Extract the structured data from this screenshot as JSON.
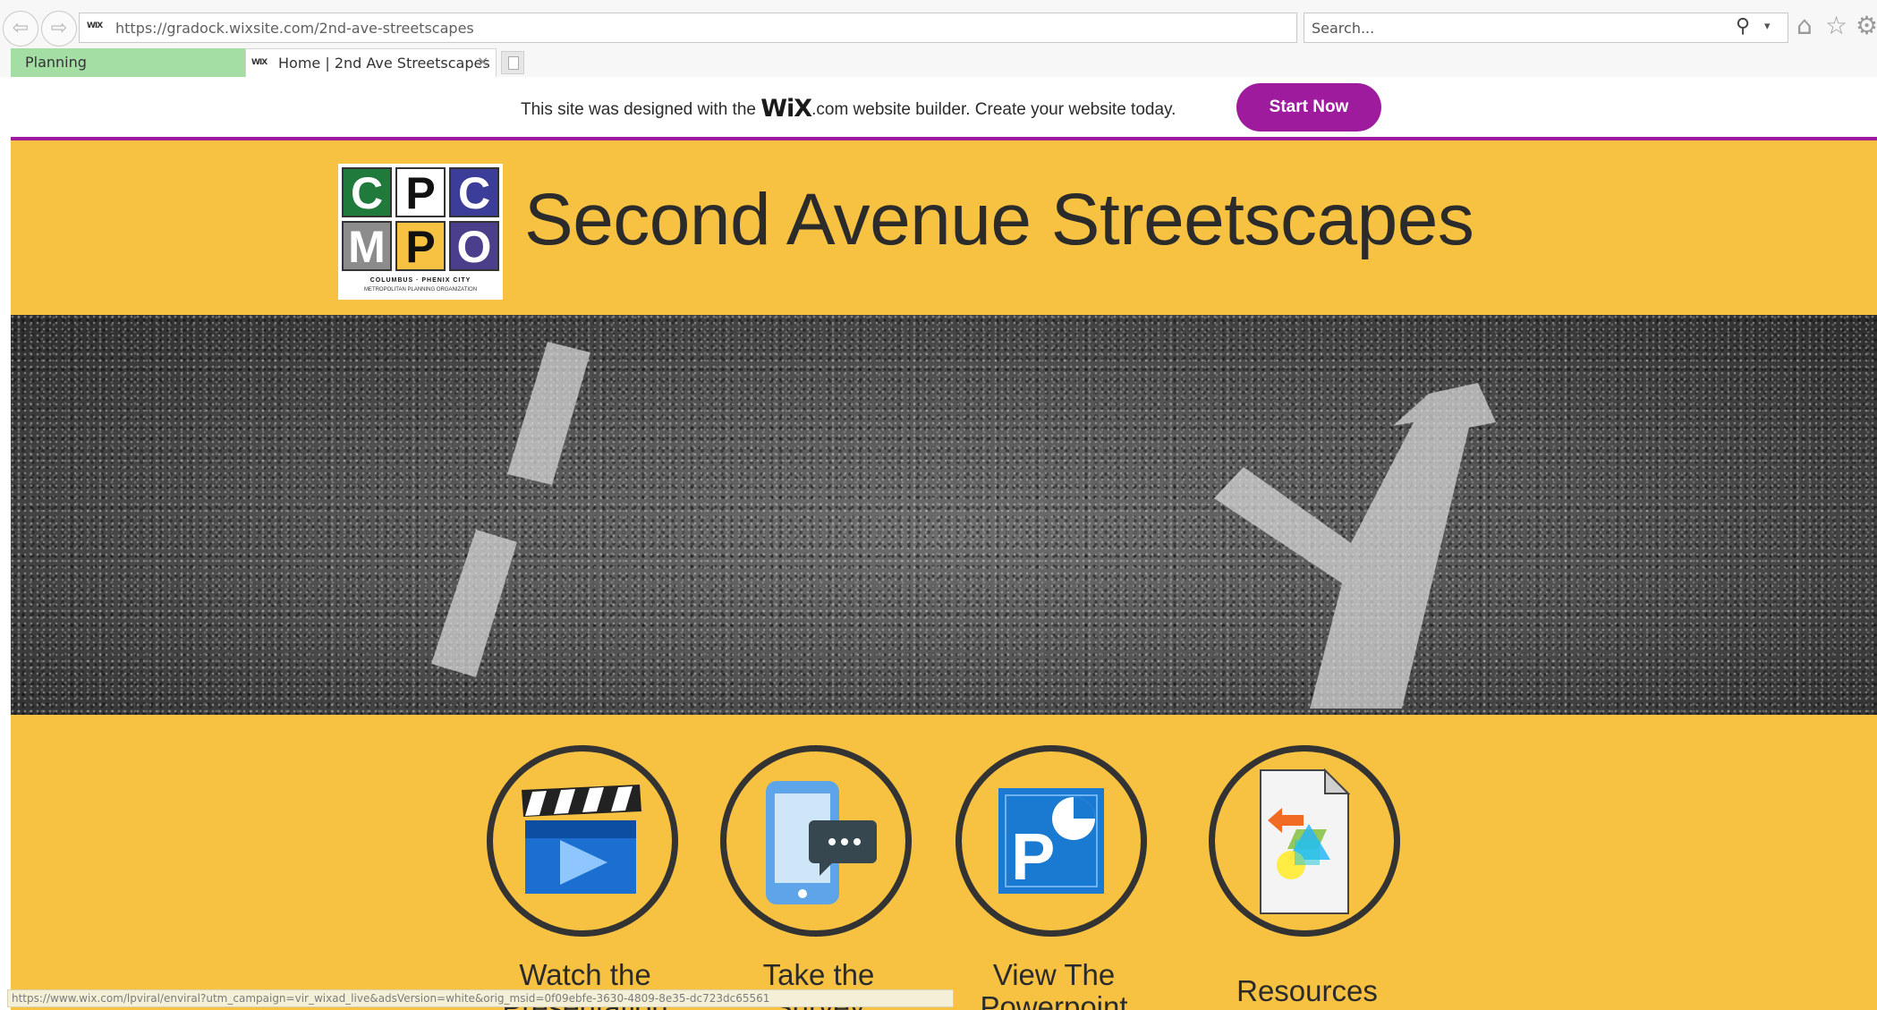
{
  "browser": {
    "address": {
      "favicon": "WIX",
      "url": "https://gradock.wixsite.com/2nd-ave-streetscapes"
    },
    "search": {
      "placeholder": "Search..."
    },
    "icons": [
      "back-icon",
      "forward-icon",
      "lock-icon",
      "refresh-icon",
      "search-icon",
      "home-icon",
      "star-icon",
      "gear-icon"
    ],
    "tab_group": {
      "label": "Planning",
      "color": "#a4dea4"
    },
    "tabs": [
      {
        "favicon": "WIX",
        "title": "Home | 2nd Ave Streetscapes",
        "close": "×",
        "active": true
      }
    ]
  },
  "banner": {
    "text_before": "This site was designed with the ",
    "brand": "WiX",
    "text_after": ".com website builder. Create your website today.",
    "button_label": "Start Now",
    "accent": "#9e1b9e"
  },
  "page": {
    "background": "#f7c242",
    "logo": {
      "letters": [
        "C",
        "P",
        "C",
        "M",
        "P",
        "O"
      ],
      "colors": [
        "#1f7a3b",
        "#ffffff",
        "#3b3d99",
        "#8c8c8c",
        "#f7c242",
        "#4b3f8c"
      ],
      "subtitle_line1": "COLUMBUS · PHENIX CITY",
      "subtitle_line2": "METROPOLITAN PLANNING ORGANIZATION"
    },
    "title": "Second Avenue Streetscapes",
    "actions": [
      {
        "label_line1": "Watch the",
        "label_line2": "Presentation",
        "icon": "video-clapper-icon"
      },
      {
        "label_line1": "Take the",
        "label_line2": "Survey",
        "icon": "tablet-chat-icon"
      },
      {
        "label_line1": "View The",
        "label_line2": "Powerpoint",
        "icon": "powerpoint-icon"
      },
      {
        "label_line1": "Resources",
        "label_line2": "",
        "icon": "document-shapes-icon"
      }
    ]
  },
  "status_bar": {
    "url": "https://www.wix.com/lpviral/enviral?utm_campaign=vir_wixad_live&adsVersion=white&orig_msid=0f09ebfe-3630-4809-8e35-dc723dc65561"
  }
}
